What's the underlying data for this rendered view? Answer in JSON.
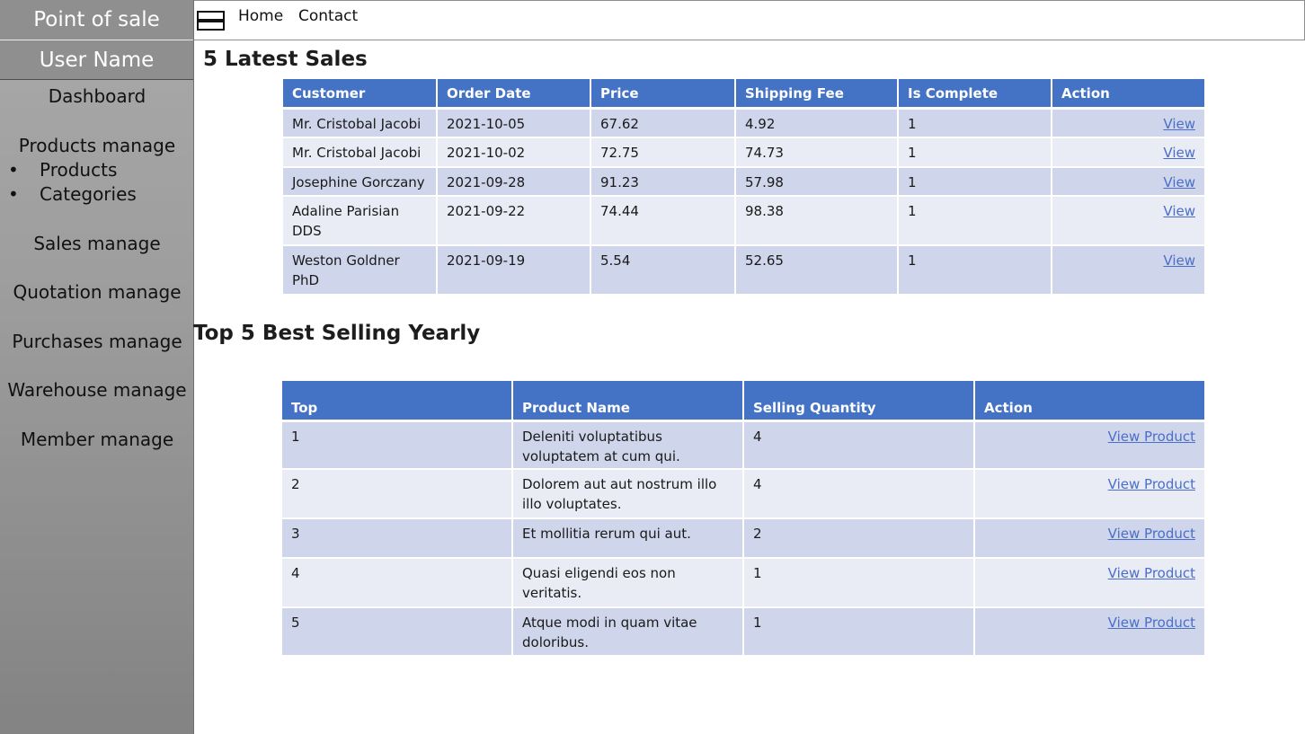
{
  "sidebar": {
    "brand": "Point of sale",
    "user": "User Name",
    "dashboard": "Dashboard",
    "products_manage": "Products manage",
    "sub_items": [
      {
        "bullet": "•",
        "label": "Products"
      },
      {
        "bullet": "•",
        "label": "Categories"
      }
    ],
    "sales_manage": "Sales manage",
    "quotation_manage": "Quotation manage",
    "purchases_manage": "Purchases manage",
    "warehouse_manage": "Warehouse manage",
    "member_manage": "Member manage"
  },
  "topbar": {
    "menu_icon": "hamburger-menu-icon",
    "home": "Home",
    "contact": "Contact"
  },
  "latest_sales": {
    "title": "5 Latest Sales",
    "headers": [
      "Customer",
      "Order Date",
      "Price",
      "Shipping Fee",
      "Is Complete",
      "Action"
    ],
    "rows": [
      {
        "customer": "Mr. Cristobal Jacobi",
        "date": "2021-10-05",
        "price": "67.62",
        "fee": "4.92",
        "complete": "1",
        "action": "View"
      },
      {
        "customer": "Mr. Cristobal Jacobi",
        "date": "2021-10-02",
        "price": "72.75",
        "fee": "74.73",
        "complete": "1",
        "action": "View"
      },
      {
        "customer": "Josephine Gorczany",
        "date": "2021-09-28",
        "price": "91.23",
        "fee": "57.98",
        "complete": "1",
        "action": "View"
      },
      {
        "customer": "Adaline Parisian DDS",
        "date": "2021-09-22",
        "price": "74.44",
        "fee": "98.38",
        "complete": "1",
        "action": "View"
      },
      {
        "customer": "Weston Goldner PhD",
        "date": "2021-09-19",
        "price": "5.54",
        "fee": "52.65",
        "complete": "1",
        "action": "View"
      }
    ]
  },
  "best_selling": {
    "title": "Top 5 Best Selling Yearly",
    "headers": [
      "Top",
      "Product Name",
      "Selling Quantity",
      "Action"
    ],
    "rows": [
      {
        "top": "1",
        "name": "Deleniti voluptatibus voluptatem at cum qui.",
        "qty": "4",
        "action": "View Product"
      },
      {
        "top": "2",
        "name": "Dolorem aut aut nostrum illo illo voluptates.",
        "qty": "4",
        "action": "View Product"
      },
      {
        "top": "3",
        "name": "Et mollitia rerum qui aut.",
        "qty": "2",
        "action": "View Product"
      },
      {
        "top": "4",
        "name": "Quasi eligendi eos non veritatis.",
        "qty": "1",
        "action": "View Product"
      },
      {
        "top": "5",
        "name": "Atque modi in quam vitae doloribus.",
        "qty": "1",
        "action": "View Product"
      }
    ]
  }
}
